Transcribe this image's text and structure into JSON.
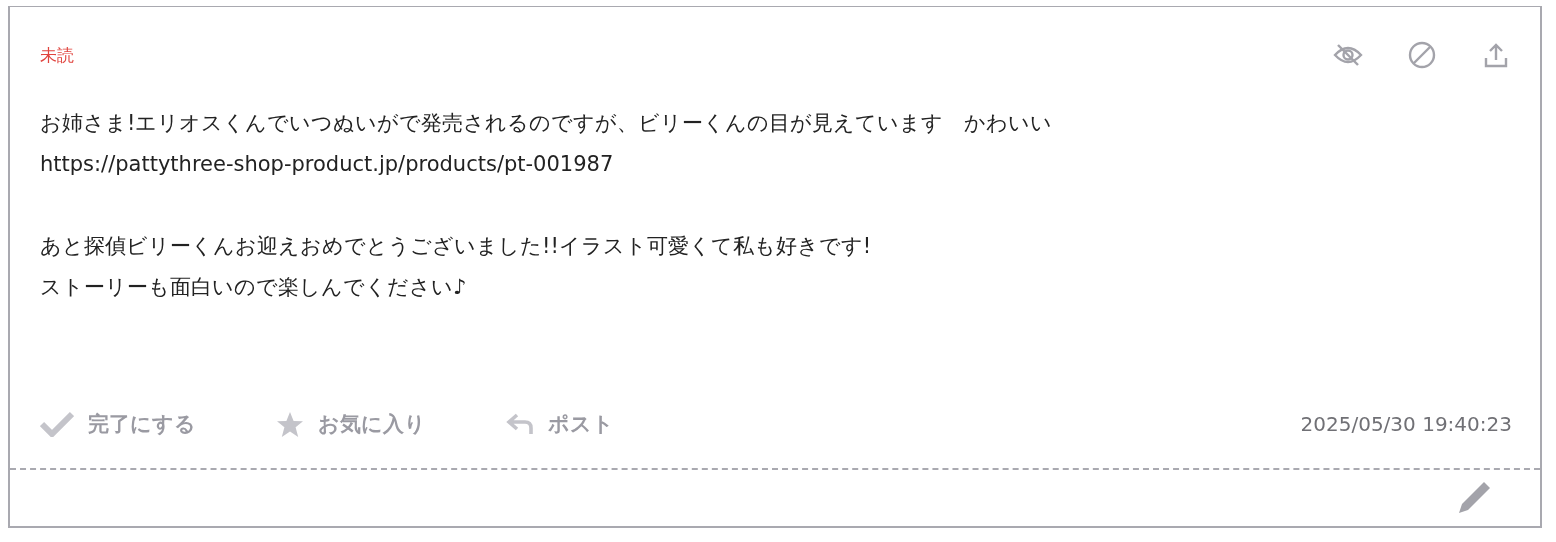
{
  "message": {
    "status": {
      "kind": "unread",
      "label": "未読"
    },
    "tools": [
      {
        "kind": "hide"
      },
      {
        "kind": "block"
      },
      {
        "kind": "share"
      }
    ],
    "paragraphs": [
      [
        "お姉さま!エリオスくんでいつぬいがで発売されるのですが、ビリーくんの目が見えています　かわいい",
        "https://pattythree-shop-product.jp/products/pt-001987"
      ],
      [
        "あと探偵ビリーくんお迎えおめでとうございました!!イラスト可愛くて私も好きです!",
        "ストーリーも面白いので楽しんでください♪"
      ]
    ],
    "actions": [
      {
        "kind": "done",
        "label": "完了にする",
        "active": false
      },
      {
        "kind": "favorite",
        "label": "お気に入り",
        "active": false
      },
      {
        "kind": "reply",
        "label": "ポスト",
        "active": false
      }
    ],
    "timestamp": "2025/05/30 19:40:23"
  }
}
